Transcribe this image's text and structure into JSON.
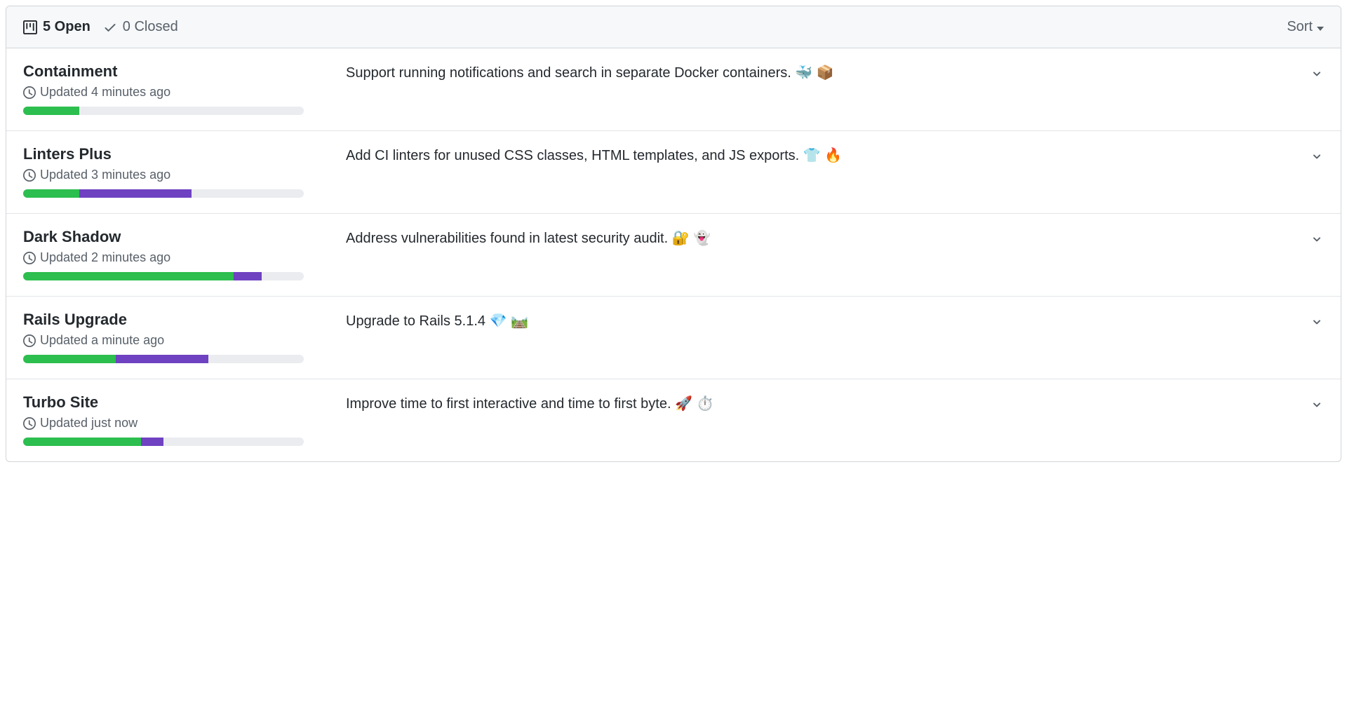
{
  "header": {
    "open_label": "5 Open",
    "closed_label": "0 Closed",
    "sort_label": "Sort"
  },
  "projects": [
    {
      "title": "Containment",
      "updated": "Updated 4 minutes ago",
      "description": "Support running notifications and search in separate Docker containers. 🐳 📦",
      "progress_green_pct": 20,
      "progress_purple_pct": 0
    },
    {
      "title": "Linters Plus",
      "updated": "Updated 3 minutes ago",
      "description": "Add CI linters for unused CSS classes, HTML templates, and JS exports. 👕 🔥",
      "progress_green_pct": 20,
      "progress_purple_pct": 40
    },
    {
      "title": "Dark Shadow",
      "updated": "Updated 2 minutes ago",
      "description": "Address vulnerabilities found in latest security audit. 🔐 👻",
      "progress_green_pct": 75,
      "progress_purple_pct": 10
    },
    {
      "title": "Rails Upgrade",
      "updated": "Updated a minute ago",
      "description": "Upgrade to Rails 5.1.4 💎 🛤️",
      "progress_green_pct": 33,
      "progress_purple_pct": 33
    },
    {
      "title": "Turbo Site",
      "updated": "Updated just now",
      "description": "Improve time to first interactive and time to first byte. 🚀 ⏱️",
      "progress_green_pct": 42,
      "progress_purple_pct": 8
    }
  ]
}
